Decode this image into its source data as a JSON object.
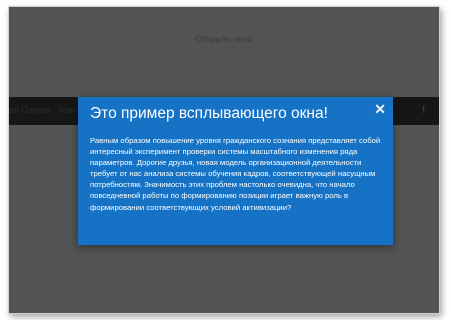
{
  "page": {
    "open_link_label": "Открыть окно",
    "navbar_text": "ая Пагина · Ком",
    "navbar_icon": "f"
  },
  "modal": {
    "title": "Это пример всплывающего окна!",
    "close_glyph": "✕",
    "body": "Равным образом повышение уровня гражданского сознания представляет собой интересный эксперимент проверки системы масштабного изменения ряда параметров. Дорогие друзья, новая модель организационной деятельности требует от нас анализа системы обучения кадров, соответствующей насущным потребностям. Значимость этих проблем настолько очевидна, что начало повседневной работы по формированию позиции играет важную роль в формировании соответствующих условий активизации?"
  },
  "colors": {
    "overlay": "#525354",
    "navbar": "#161617",
    "modal_bg": "#1572c4",
    "modal_text": "#ffffff"
  }
}
